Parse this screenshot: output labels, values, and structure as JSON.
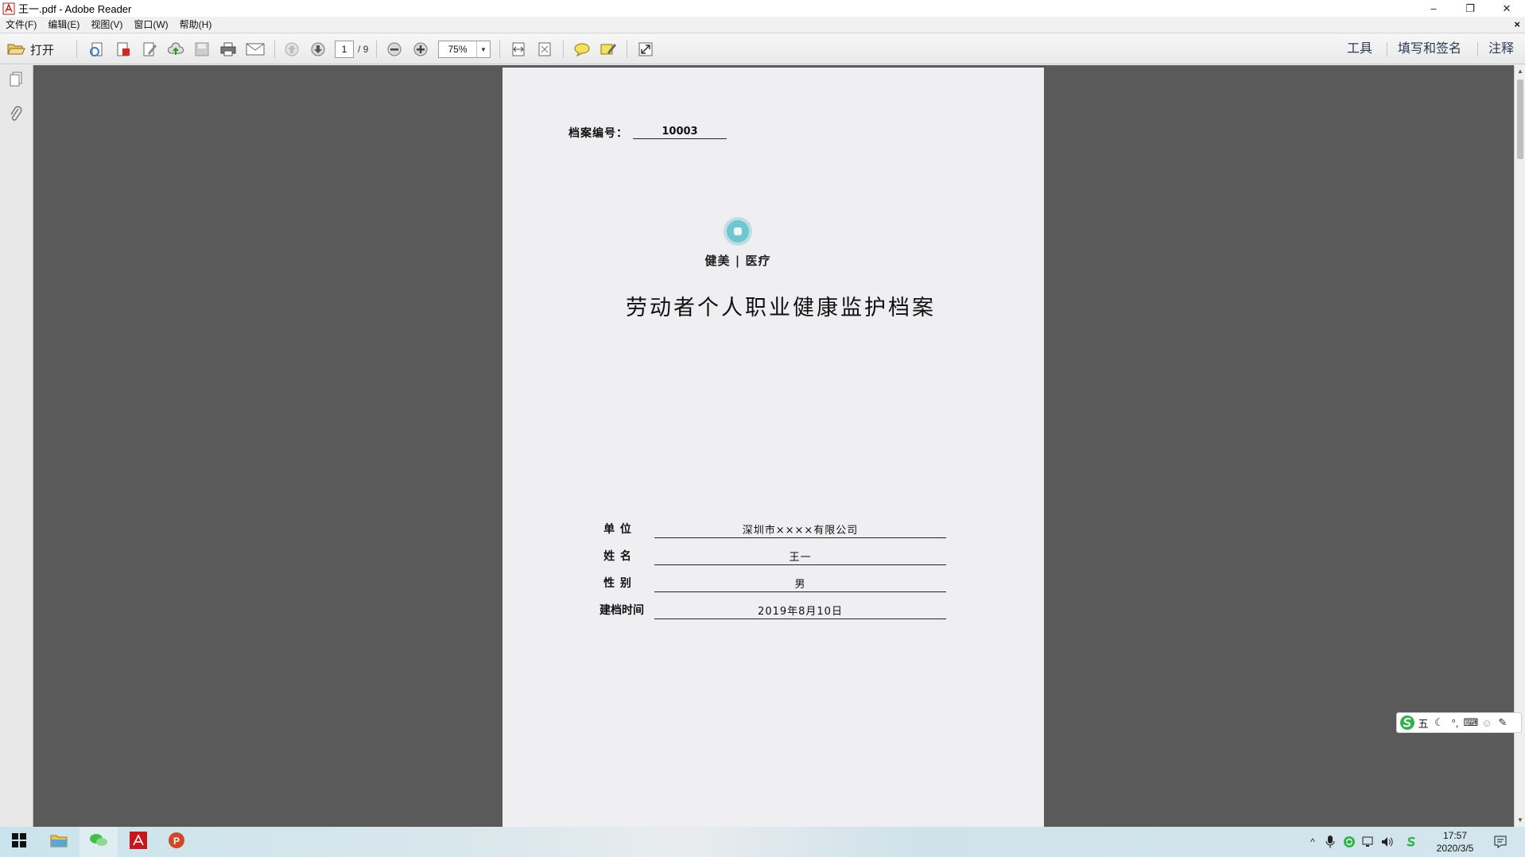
{
  "window": {
    "title": "王一.pdf - Adobe Reader",
    "minimize": "–",
    "restore": "❐",
    "close": "✕"
  },
  "menubar": {
    "items": [
      "文件(F)",
      "编辑(E)",
      "视图(V)",
      "窗口(W)",
      "帮助(H)"
    ],
    "close": "×"
  },
  "toolbar": {
    "open_label": "打开",
    "page_current": "1",
    "page_total": "/ 9",
    "zoom": "75%",
    "right_tools": [
      "工具",
      "填写和签名",
      "注释"
    ]
  },
  "document": {
    "archive_label": "档案编号：",
    "archive_number": "10003",
    "logo_text": "健美 | 医疗",
    "title": "劳动者个人职业健康监护档案",
    "fields": [
      {
        "label": "单 位",
        "value": "深圳市××××有限公司"
      },
      {
        "label": "姓 名",
        "value": "王一"
      },
      {
        "label": "性 别",
        "value": "男"
      },
      {
        "label": "建档时间",
        "value": "2019年8月10日"
      }
    ]
  },
  "ime": {
    "mode": "五"
  },
  "taskbar": {
    "time": "17:57",
    "date": "2020/3/5"
  },
  "colors": {
    "doc_background": "#5a5a5a",
    "page": "#efeef0",
    "logo_teal": "#6ec6cf",
    "accent_right_tools": "#2b3a55"
  }
}
